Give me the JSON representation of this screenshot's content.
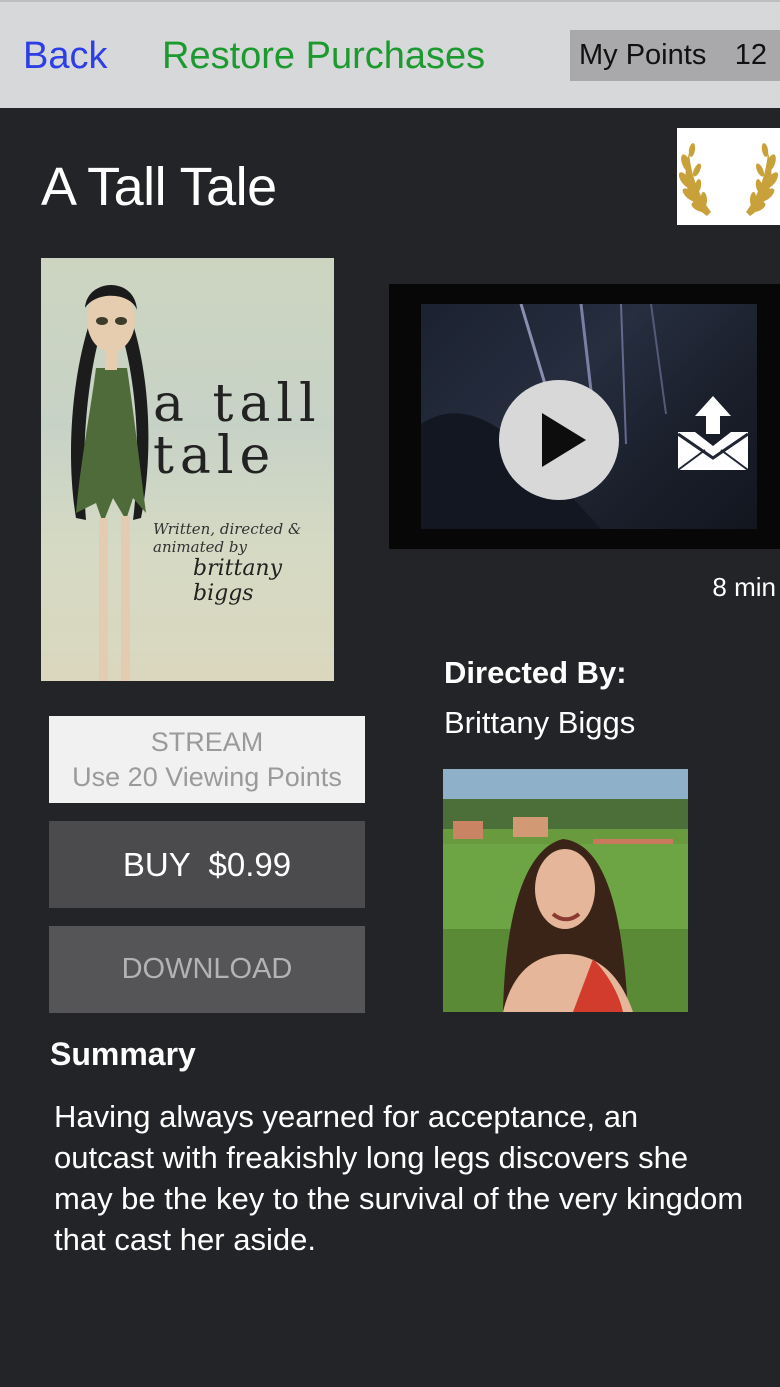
{
  "header": {
    "back_label": "Back",
    "restore_label": "Restore Purchases",
    "points_label": "My Points",
    "points_value": "12"
  },
  "film": {
    "title": "A Tall Tale",
    "duration": "8 min",
    "poster": {
      "title": "a tall tale",
      "credit": "Written, directed & animated by",
      "author": "brittany biggs"
    }
  },
  "actions": {
    "stream_label": "STREAM",
    "stream_sublabel": "Use 20 Viewing Points",
    "buy_label": "BUY  $0.99",
    "download_label": "DOWNLOAD"
  },
  "director": {
    "heading": "Directed By:",
    "name": "Brittany Biggs"
  },
  "summary": {
    "heading": "Summary",
    "text": "Having always yearned for acceptance, an outcast with freakishly long legs discovers she may be the key to the survival of the very kingdom that cast her aside."
  },
  "icons": {
    "award": "laurel-wreath-icon",
    "play": "play-icon",
    "share": "share-envelope-icon"
  },
  "colors": {
    "background": "#232427",
    "topbar": "#d7d8da",
    "back_link": "#2d3ee6",
    "restore_link": "#1d9a2f"
  }
}
